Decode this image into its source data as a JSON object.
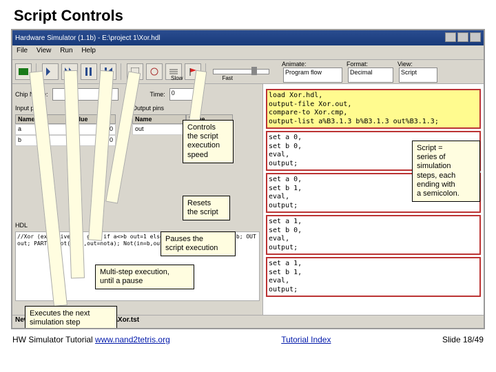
{
  "slide": {
    "title": "Script Controls",
    "footer_left_prefix": "HW Simulator Tutorial ",
    "footer_left_link": "www.nand2tetris.org",
    "footer_center": "Tutorial Index",
    "footer_right": "Slide 18/49"
  },
  "window": {
    "title": "Hardware Simulator (1.1b) - E:\\project 1\\Xor.hdl",
    "menus": {
      "file": "File",
      "view": "View",
      "run": "Run",
      "help": "Help"
    }
  },
  "toolbar": {
    "icons": {
      "chips": "chips-icon",
      "step": "step-icon",
      "run": "run-icon",
      "pause": "pause-icon",
      "reset": "reset-icon",
      "calc": "calc-icon",
      "clock": "clock-icon",
      "list": "list-icon",
      "flag": "flag-icon"
    },
    "slow": "Slow",
    "fast": "Fast",
    "animate_label": "Animate:",
    "animate_value": "Program flow",
    "format_label": "Format:",
    "format_value": "Decimal",
    "view_label": "View:",
    "view_value": "Script"
  },
  "left": {
    "chip_name_label": "Chip Name:",
    "chip_name_value": "",
    "time_label": "Time:",
    "time_value": "0",
    "input_pins": "Input pins",
    "output_pins": "Output pins",
    "name_hdr": "Name",
    "value_hdr": "Value",
    "in_a": "a",
    "in_a_val": "0",
    "in_b": "b",
    "in_b_val": "0",
    "out": "out",
    "out_val": "0",
    "hdl_label": "HDL",
    "hdl_text": "//Xor (exclusive or) gate\n if a<>b out=1 else out=0\nCHIP Xor{\n  IN a,b;\n  OUT out;\n  PARTS:\n  Not(in=a,out=nota);\n  Not(in=b,out=notb);"
  },
  "script": {
    "header": [
      "load Xor.hdl,",
      "output-file Xor.out,",
      "compare-to Xor.cmp,",
      "output-list a%B3.1.3 b%B3.1.3 out%B3.1.3;"
    ],
    "b1": [
      "set a 0,",
      "set b 0,",
      "eval,",
      "output;"
    ],
    "b2": [
      "set a 0,",
      "set b 1,",
      "eval,",
      "output;"
    ],
    "b3": [
      "set a 1,",
      "set b 0,",
      "eval,",
      "output;"
    ],
    "b4": [
      "set a 1,",
      "set b 1,",
      "eval,",
      "output;"
    ]
  },
  "callouts": {
    "speed": "Controls\nthe script\nexecution\nspeed",
    "reset": "Resets\nthe script",
    "pause": "Pauses the\nscript execution",
    "multi": "Multi-step execution,\nuntil a pause",
    "step": "Executes the next\nsimulation step",
    "script_def": "Script =\nseries of\nsimulation\nsteps, each\nending with\na semicolon."
  },
  "status": {
    "text": "New script loaded: E:\\project 1\\Xor.tst"
  }
}
